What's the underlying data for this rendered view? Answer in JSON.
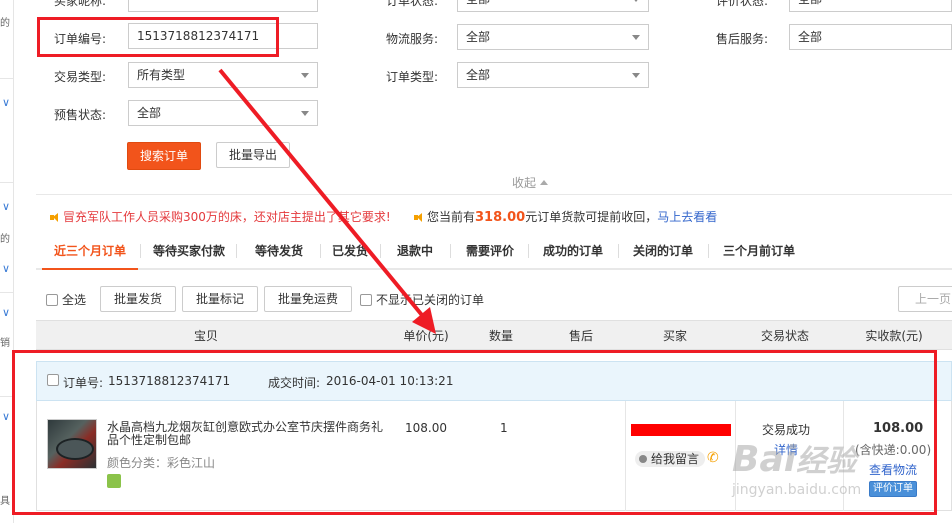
{
  "filters": {
    "buyer_nick_label": "买家昵称:",
    "order_status_label": "订单状态:",
    "order_status_value": "全部",
    "review_status_label": "评价状态:",
    "review_status_value": "全部",
    "order_no_label": "订单编号:",
    "order_no_value": "1513718812374171",
    "logistics_label": "物流服务:",
    "logistics_value": "全部",
    "aftersale_label": "售后服务:",
    "aftersale_value": "全部",
    "trade_type_label": "交易类型:",
    "trade_type_value": "所有类型",
    "order_type_label": "订单类型:",
    "order_type_value": "全部",
    "presale_label": "预售状态:",
    "presale_value": "全部"
  },
  "actions": {
    "search_label": "搜索订单",
    "export_label": "批量导出",
    "collapse_label": "收起"
  },
  "notices": {
    "n1": "冒充军队工作人员采购300万的床，还对店主提出了其它要求!",
    "n2_prefix": "您当前有",
    "n2_amount": "318.00",
    "n2_suffix": "元订单货款可提前收回，",
    "n2_link": "马上去看看"
  },
  "tabs": [
    {
      "label": "近三个月订单"
    },
    {
      "label": "等待买家付款"
    },
    {
      "label": "等待发货"
    },
    {
      "label": "已发货"
    },
    {
      "label": "退款中"
    },
    {
      "label": "需要评价"
    },
    {
      "label": "成功的订单"
    },
    {
      "label": "关闭的订单"
    },
    {
      "label": "三个月前订单"
    }
  ],
  "bulk": {
    "select_all": "全选",
    "batch_ship": "批量发货",
    "batch_mark": "批量标记",
    "batch_free_ship": "批量免运费",
    "hide_closed": "不显示已关闭的订单",
    "prev_page": "上一页"
  },
  "columns": {
    "item": "宝贝",
    "price": "单价(元)",
    "qty": "数量",
    "aftersale": "售后",
    "buyer": "买家",
    "status": "交易状态",
    "paid": "实收款(元)"
  },
  "order": {
    "no_label": "订单号:",
    "no_value": "1513718812374171",
    "time_label": "成交时间:",
    "time_value": "2016-04-01 10:13:21",
    "title": "水晶高档九龙烟灰缸创意欧式办公室节庆摆件商务礼品个性定制包邮",
    "variant": "颜色分类：彩色江山",
    "price": "108.00",
    "qty": "1",
    "message_label": "给我留言",
    "status_text": "交易成功",
    "detail_link": "详情",
    "paid": "108.00",
    "shipping_note": "(含快递:0.00)",
    "view_logistics": "查看物流",
    "bottom_btn": "评价订单"
  },
  "watermark": {
    "brand": "Bai",
    "brand_suffix": "经验",
    "url": "jingyan.baidu.com"
  },
  "colors": {
    "accent": "#f2541b",
    "annotation": "#ee1c25",
    "link": "#3366cc"
  }
}
